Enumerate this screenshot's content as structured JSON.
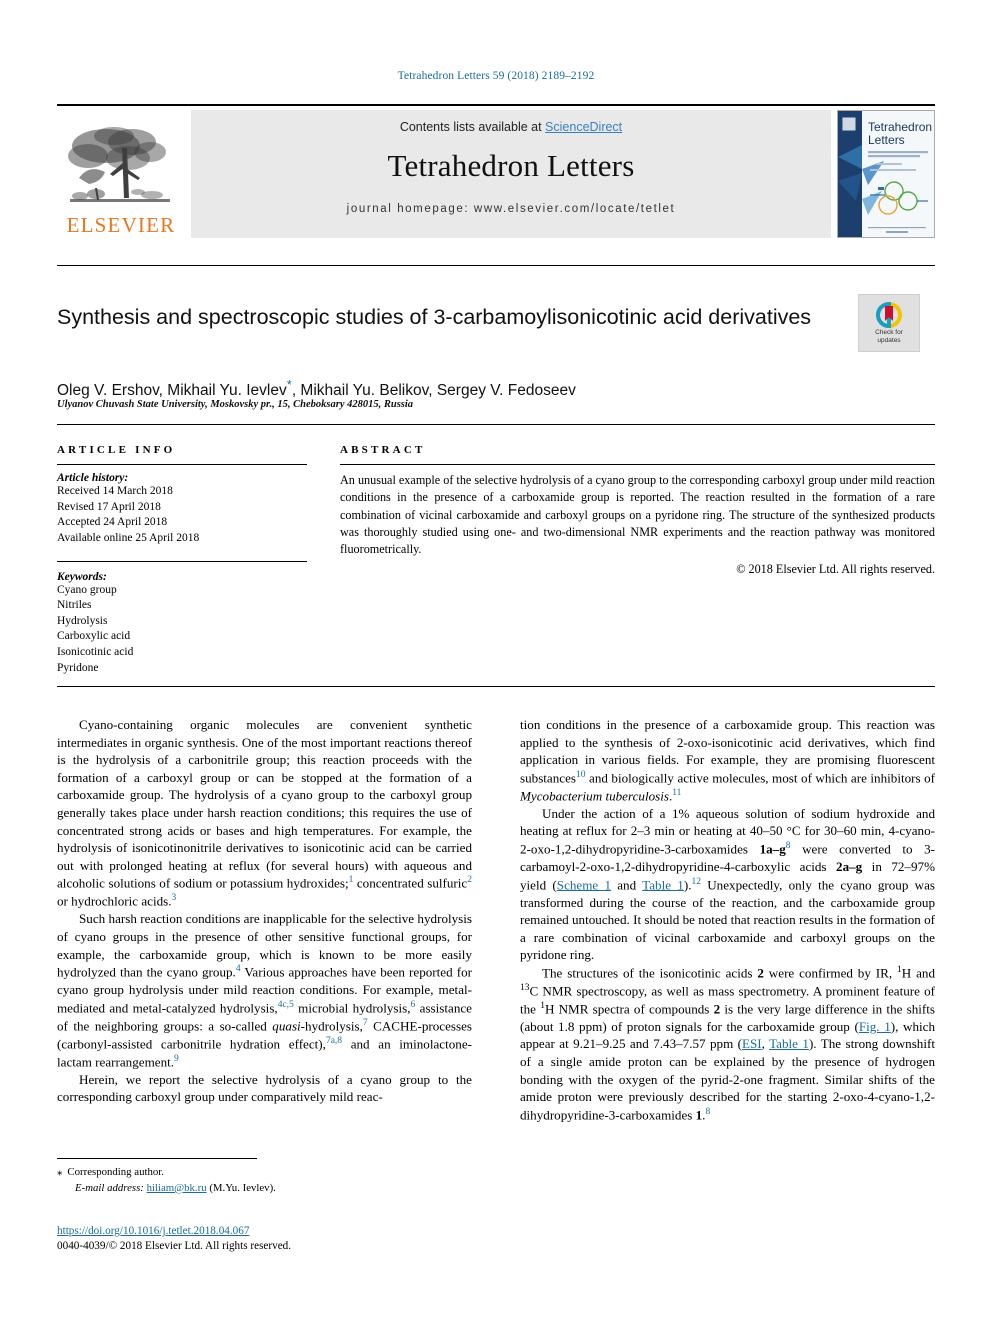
{
  "running_head": "Tetrahedron Letters 59 (2018) 2189–2192",
  "masthead": {
    "publisher": "ELSEVIER",
    "contents_prefix": "Contents lists available at ",
    "contents_link": "ScienceDirect",
    "journal_title": "Tetrahedron Letters",
    "homepage": "journal homepage: www.elsevier.com/locate/tetlet",
    "cover_title_line1": "Tetrahedron",
    "cover_title_line2": "Letters"
  },
  "article": {
    "title": "Synthesis and spectroscopic studies of 3-carbamoylisonicotinic acid derivatives",
    "authors_part1": "Oleg V. Ershov, Mikhail Yu. Ievlev",
    "authors_star": "*",
    "authors_part2": ", Mikhail Yu. Belikov, Sergey V. Fedoseev",
    "affiliation": "Ulyanov Chuvash State University, Moskovsky pr., 15, Cheboksary 428015, Russia",
    "crossmark_line1": "Check for",
    "crossmark_line2": "updates"
  },
  "article_info": {
    "heading": "ARTICLE INFO",
    "history_label": "Article history:",
    "history": [
      "Received 14 March 2018",
      "Revised 17 April 2018",
      "Accepted 24 April 2018",
      "Available online 25 April 2018"
    ],
    "keywords_label": "Keywords:",
    "keywords": [
      "Cyano group",
      "Nitriles",
      "Hydrolysis",
      "Carboxylic acid",
      "Isonicotinic acid",
      "Pyridone"
    ]
  },
  "abstract": {
    "heading": "ABSTRACT",
    "text": "An unusual example of the selective hydrolysis of a cyano group to the corresponding carboxyl group under mild reaction conditions in the presence of a carboxamide group is reported. The reaction resulted in the formation of a rare combination of vicinal carboxamide and carboxyl groups on a pyridone ring. The structure of the synthesized products was thoroughly studied using one- and two-dimensional NMR experiments and the reaction pathway was monitored fluorometrically.",
    "copyright": "© 2018 Elsevier Ltd. All rights reserved."
  },
  "body": {
    "left": {
      "p1_a": "Cyano-containing organic molecules are convenient synthetic intermediates in organic synthesis. One of the most important reactions thereof is the hydrolysis of a carbonitrile group; this reaction proceeds with the formation of a carboxyl group or can be stopped at the formation of a carboxamide group. The hydrolysis of a cyano group to the carboxyl group generally takes place under harsh reaction conditions; this requires the use of concentrated strong acids or bases and high temperatures. For example, the hydrolysis of isonicotinonitrile derivatives to isonicotinic acid can be carried out with prolonged heating at reflux (for several hours) with aqueous and alcoholic solutions of sodium or potassium hydroxides;",
      "p1_ref1": "1",
      "p1_b": " concentrated sulfuric",
      "p1_ref2": "2",
      "p1_c": " or hydrochloric acids.",
      "p1_ref3": "3",
      "p2_a": "Such harsh reaction conditions are inapplicable for the selective hydrolysis of cyano groups in the presence of other sensitive functional groups, for example, the carboxamide group, which is known to be more easily hydrolyzed than the cyano group.",
      "p2_ref1": "4",
      "p2_b": " Various approaches have been reported for cyano group hydrolysis under mild reaction conditions. For example, metal-mediated and metal-catalyzed hydrolysis,",
      "p2_ref2": "4c,5",
      "p2_c": " microbial hydrolysis,",
      "p2_ref3": "6",
      "p2_d": " assistance of the neighboring groups: a so-called ",
      "p2_italic": "quasi",
      "p2_e": "-hydrolysis,",
      "p2_ref4": "7",
      "p2_f": " CACHE-processes (carbonyl-assisted carbonitrile hydration effect),",
      "p2_ref5": "7a,8",
      "p2_g": " and an iminolactone-lactam rearrangement.",
      "p2_ref6": "9",
      "p3": "Herein, we report the selective hydrolysis of a cyano group to the corresponding carboxyl group under comparatively mild reac-"
    },
    "right": {
      "p1_a": "tion conditions in the presence of a carboxamide group. This reaction was applied to the synthesis of 2-oxo-isonicotinic acid derivatives, which find application in various fields. For example, they are promising fluorescent substances",
      "p1_ref1": "10",
      "p1_b": " and biologically active molecules, most of which are inhibitors of ",
      "p1_italic": "Mycobacterium tuberculosis",
      "p1_c": ".",
      "p1_ref2": "11",
      "p2_a": "Under the action of a 1% aqueous solution of sodium hydroxide and heating at reflux for 2–3 min or heating at 40–50 °C for 30–60 min, 4-cyano-2-oxo-1,2-dihydropyridine-3-carboxamides ",
      "p2_b1": "1a–g",
      "p2_ref1": "8",
      "p2_c": " were converted to 3-carbamoyl-2-oxo-1,2-dihydropyridine-4-carboxylic acids ",
      "p2_b2": "2a–g",
      "p2_d": " in 72–97% yield (",
      "p2_link1": "Scheme 1",
      "p2_e": " and ",
      "p2_link2": "Table 1",
      "p2_f": ").",
      "p2_ref2": "12",
      "p2_g": " Unexpectedly, only the cyano group was transformed during the course of the reaction, and the carboxamide group remained untouched. It should be noted that reaction results in the formation of a rare combination of vicinal carboxamide and carboxyl groups on the pyridone ring.",
      "p3_a": "The structures of the isonicotinic acids ",
      "p3_b1": "2",
      "p3_b": " were confirmed by IR, ",
      "p3_sup1": "1",
      "p3_c": "H and ",
      "p3_sup2": "13",
      "p3_d": "C NMR spectroscopy, as well as mass spectrometry. A prominent feature of the ",
      "p3_sup3": "1",
      "p3_e": "H NMR spectra of compounds ",
      "p3_b2": "2",
      "p3_f": " is the very large difference in the shifts (about 1.8 ppm) of proton signals for the carboxamide group (",
      "p3_link1": "Fig. 1",
      "p3_g": "), which appear at 9.21–9.25 and 7.43–7.57 ppm (",
      "p3_link2": "ESI",
      "p3_h": ", ",
      "p3_link3": "Table 1",
      "p3_i": "). The strong downshift of a single amide proton can be explained by the presence of hydrogen bonding with the oxygen of the pyrid-2-one fragment. Similar shifts of the amide proton were previously described for the starting 2-oxo-4-cyano-1,2-dihydropyridine-3-carboxamides ",
      "p3_b3": "1",
      "p3_j": ".",
      "p3_ref1": "8"
    }
  },
  "footer": {
    "corresponding_star": "⁎",
    "corresponding_label": "Corresponding author.",
    "email_label": "E-mail address:",
    "email": "hiliam@bk.ru",
    "email_owner": "(M.Yu. Ievlev).",
    "doi": "https://doi.org/10.1016/j.tetlet.2018.04.067",
    "issn_line": "0040-4039/© 2018 Elsevier Ltd. All rights reserved."
  },
  "colors": {
    "link": "#1a6ba0",
    "elsevier_orange": "#E87722",
    "band_gray": "#e9e9e9"
  }
}
